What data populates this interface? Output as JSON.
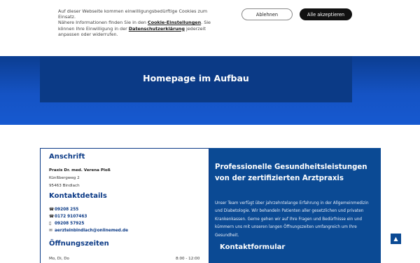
{
  "cookie": {
    "line1": "Auf dieser Webseite kommen einwilligungsbedürftige Cookies zum Einsatz.",
    "line2_pre": "Nähere Informationen finden Sie in den ",
    "settings_link": "Cookie-Einstellungen",
    "line2_mid": ". Sie können Ihre Einwilligung in der ",
    "privacy_link": "Datenschutzerklärung",
    "line2_post": " jederzeit anpassen oder widerrufen.",
    "decline_label": "Ablehnen",
    "accept_label": "Alle akzeptieren"
  },
  "hero": {
    "title": "Homepage im Aufbau"
  },
  "address": {
    "heading": "Anschrift",
    "name": "Praxis Dr. med. Verena Ploß",
    "street": "Künßbergweg 2",
    "city": "95463 Bindlach"
  },
  "contact": {
    "heading": "Kontaktdetails",
    "phone1": "09208 255",
    "phone2": "0172 9107463",
    "fax": "09208 57925",
    "email": "aerzteinbindlach@onlinemed.de"
  },
  "hours": {
    "heading": "Öffnungszeiten",
    "days": "Mo, Di, Do",
    "time": "8:00 - 12:00"
  },
  "services": {
    "title": "Professionelle Gesundheitsleistungen von der zertifizierten Arztpraxis",
    "body": "Unser Team verfügt über jahrzehntelange Erfahrung in der Allgemeinmedizin und Diabetologie. Wir behandeln Patienten aller gesetzlichen und privaten Krankenkassen. Gerne gehen wir auf Ihre Fragen und Bedürfnisse ein und kümmern uns mit unseren langen Öffnungszeiten umfangreich um Ihre Gesundheit.",
    "form_heading": "Kontaktformular"
  },
  "icons": {
    "phone": "phone-icon",
    "mobile": "mobile-icon",
    "fax": "fax-icon",
    "email": "email-icon",
    "scroll_top": "chevron-up-icon"
  },
  "colors": {
    "brand_dark": "#0b3a86",
    "brand": "#0b4a94",
    "accept_bg": "#111111"
  }
}
